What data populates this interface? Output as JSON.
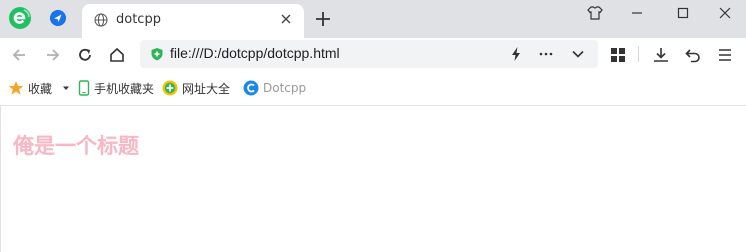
{
  "browser": {
    "tab": {
      "title": "dotcpp"
    },
    "address_bar": {
      "url": "file:///D:/dotcpp/dotcpp.html"
    },
    "bookmarks": [
      {
        "label": "收藏",
        "icon": "star-icon"
      },
      {
        "label": "手机收藏夹",
        "icon": "phone-icon"
      },
      {
        "label": "网址大全",
        "icon": "sites-icon"
      },
      {
        "label": "Dotcpp",
        "icon": "dotcpp-icon"
      }
    ]
  },
  "page": {
    "heading": "俺是一个标题",
    "heading_color": "#f7b7c4"
  }
}
